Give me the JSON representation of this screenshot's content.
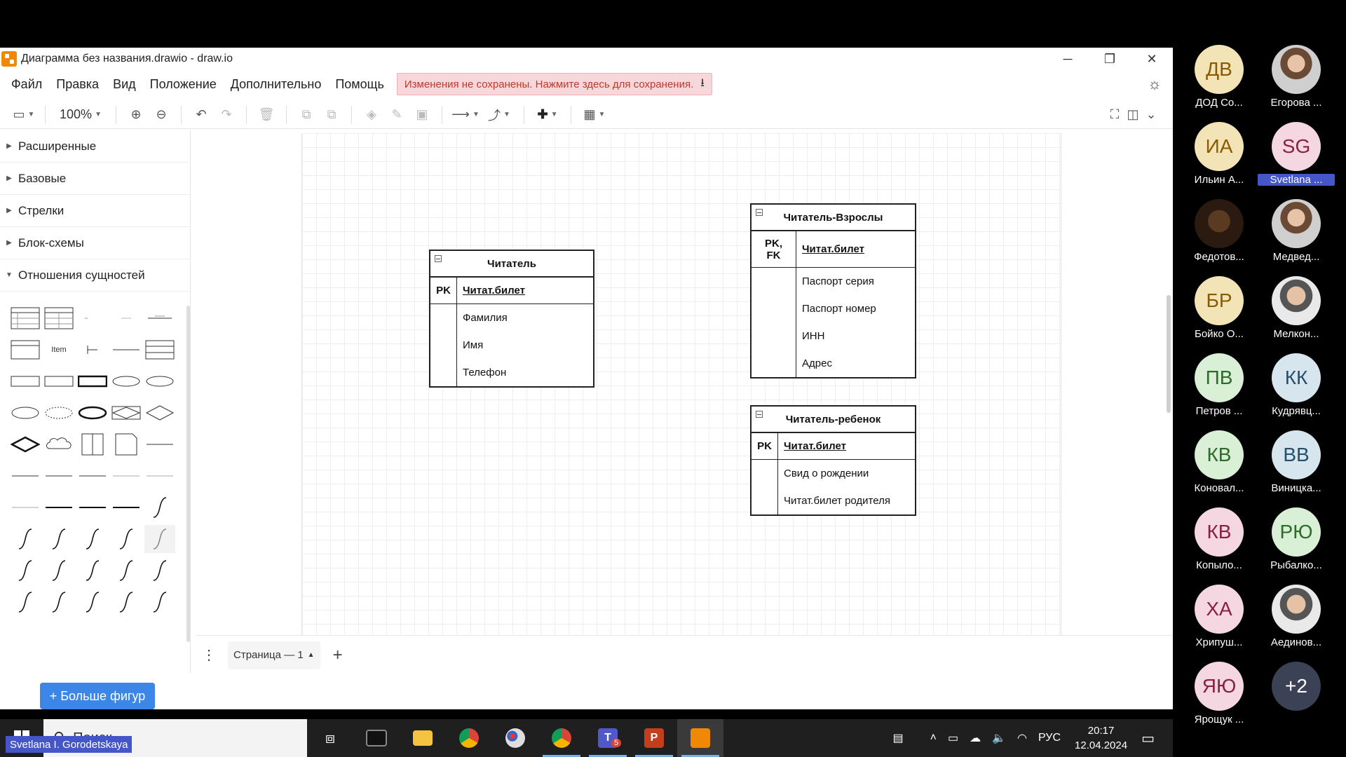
{
  "window": {
    "title": "Диаграмма без названия.drawio - draw.io"
  },
  "menu": {
    "items": [
      "Файл",
      "Правка",
      "Вид",
      "Положение",
      "Дополнительно",
      "Помощь"
    ],
    "save_banner": "Изменения не сохранены. Нажмите здесь для сохранения."
  },
  "toolbar": {
    "zoom": "100%"
  },
  "sidebar": {
    "sections": [
      "Расширенные",
      "Базовые",
      "Стрелки",
      "Блок-схемы",
      "Отношения сущностей"
    ],
    "item_shape_label": "Item",
    "more_shapes": "+ Больше фигур"
  },
  "diagram": {
    "reader": {
      "title": "Читатель",
      "pk_key": "PK",
      "pk_field": "Читат.билет",
      "fields": [
        "Фамилия",
        "Имя",
        "Телефон"
      ]
    },
    "adult": {
      "title": "Читатель-Взрослы",
      "pk_key_line1": "PK,",
      "pk_key_line2": "FK",
      "pk_field": "Читат.билет",
      "fields": [
        "Паспорт серия",
        "Паспорт номер",
        "ИНН",
        "Адрес"
      ]
    },
    "child": {
      "title": "Читатель-ребенок",
      "pk_key": "PK",
      "pk_field": "Читат.билет",
      "fields": [
        "Свид о рождении",
        "Читат.билет родителя"
      ]
    }
  },
  "pages": {
    "tab_label": "Страница — 1"
  },
  "taskbar": {
    "search_placeholder": "Поиск",
    "lang": "РУС",
    "time": "20:17",
    "date": "12.04.2024",
    "teams_badge": "5"
  },
  "participants": [
    {
      "initials": "ДВ",
      "name": "ДОД Со...",
      "color": "#f3e4b8",
      "text": "#8a5a00"
    },
    {
      "initials": "",
      "name": "Егорова ...",
      "photo": true
    },
    {
      "initials": "ИА",
      "name": "Ильин А...",
      "color": "#f3e4b8",
      "text": "#8a5a00"
    },
    {
      "initials": "SG",
      "name": "Svetlana ...",
      "color": "#f4d7e0",
      "text": "#8a1f45",
      "highlight": true
    },
    {
      "initials": "",
      "name": "Федотов...",
      "photo": true
    },
    {
      "initials": "",
      "name": "Медвед...",
      "photo": true
    },
    {
      "initials": "БР",
      "name": "Бойко О...",
      "color": "#f3e4b8",
      "text": "#8a5a00"
    },
    {
      "initials": "",
      "name": "Мелкон...",
      "photo": true
    },
    {
      "initials": "ПВ",
      "name": "Петров ...",
      "color": "#d9efd6",
      "text": "#2e6b2a"
    },
    {
      "initials": "КК",
      "name": "Кудрявц...",
      "color": "#d7e6ee",
      "text": "#24506b"
    },
    {
      "initials": "КВ",
      "name": "Коновал...",
      "color": "#d9efd6",
      "text": "#2e6b2a"
    },
    {
      "initials": "ВВ",
      "name": "Виницка...",
      "color": "#d7e6ee",
      "text": "#24506b"
    },
    {
      "initials": "КВ",
      "name": "Копыло...",
      "color": "#f4d7e0",
      "text": "#8a1f45"
    },
    {
      "initials": "РЮ",
      "name": "Рыбалко...",
      "color": "#d9efd6",
      "text": "#2e6b2a"
    },
    {
      "initials": "ХА",
      "name": "Хрипуш...",
      "color": "#f4d7e0",
      "text": "#8a1f45"
    },
    {
      "initials": "",
      "name": "Аединов...",
      "photo": true
    },
    {
      "initials": "ЯЮ",
      "name": "Ярощук ...",
      "color": "#f4d7e0",
      "text": "#8a1f45"
    },
    {
      "initials": "+2",
      "name": "",
      "color": "#3c4256",
      "text": "#ffffff"
    }
  ],
  "presenter": {
    "name": "Svetlana I. Gorodetskaya"
  }
}
